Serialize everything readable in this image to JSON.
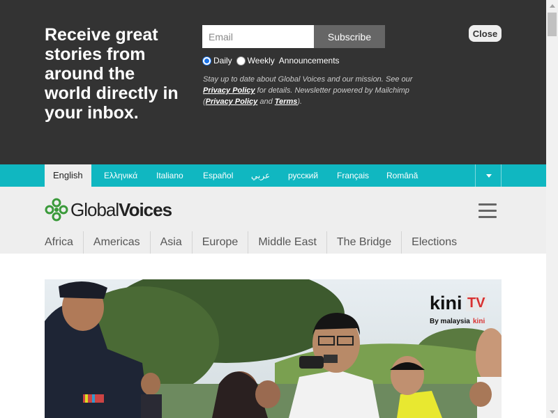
{
  "newsletter": {
    "headline": "Receive great stories from around the world directly in your inbox.",
    "email_placeholder": "Email",
    "subscribe_label": "Subscribe",
    "options": {
      "daily": "Daily",
      "weekly": "Weekly",
      "announcements": "Announcements",
      "selected": "Daily"
    },
    "fine_print": {
      "line1": "Stay up to date about Global Voices and our mission. See our",
      "privacy": "Privacy Policy",
      "line2": "for details. Newsletter powered by Mailchimp",
      "open_paren": "(",
      "privacy2": "Privacy Policy",
      "and": "and",
      "terms": "Terms",
      "close_paren": ")."
    },
    "close_label": "Close"
  },
  "languages": {
    "items": [
      "English",
      "Ελληνικά",
      "Italiano",
      "Español",
      "عربي",
      "русский",
      "Français",
      "Română"
    ],
    "active": "English"
  },
  "header": {
    "logo_part1": "Global",
    "logo_part2": "Voices",
    "regions": [
      "Africa",
      "Americas",
      "Asia",
      "Europe",
      "Middle East",
      "The Bridge",
      "Elections"
    ]
  },
  "hero": {
    "watermark_brand": "kini",
    "watermark_tv": "TV",
    "watermark_by": "By malaysia",
    "watermark_kini": "kini"
  },
  "colors": {
    "banner_bg": "#333333",
    "lang_bar": "#10b7c1",
    "header_bg": "#eeeeee",
    "logo_green": "#3a9a3a"
  }
}
